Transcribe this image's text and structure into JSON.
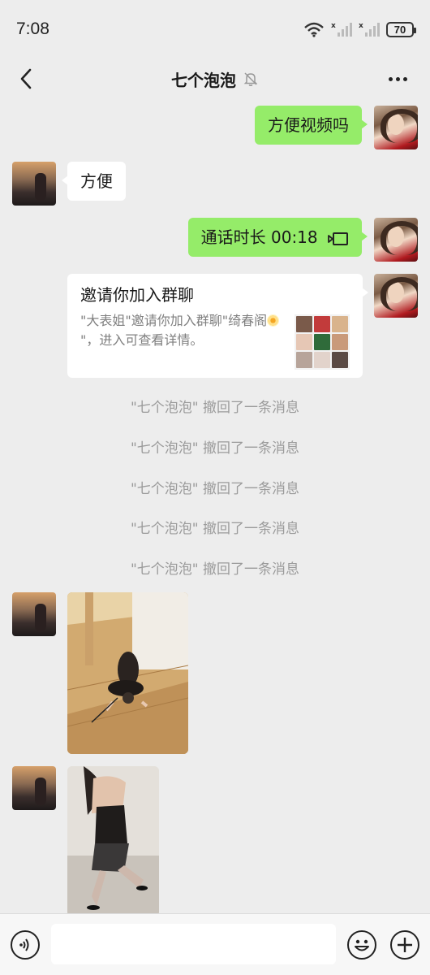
{
  "status_bar": {
    "time": "7:08",
    "battery": "70"
  },
  "header": {
    "title": "七个泡泡"
  },
  "messages": {
    "m1_text": "方便视频吗",
    "m2_text": "方便",
    "m3_text": "通话时长 00:18",
    "invite": {
      "title": "邀请你加入群聊",
      "desc_part1": "\"大表姐\"邀请你加入群聊\"绮春阁",
      "desc_part2": "\"，进入可查看详情。"
    },
    "recalls": [
      "\"七个泡泡\" 撤回了一条消息",
      "\"七个泡泡\" 撤回了一条消息",
      "\"七个泡泡\" 撤回了一条消息",
      "\"七个泡泡\" 撤回了一条消息",
      "\"七个泡泡\" 撤回了一条消息"
    ]
  },
  "input": {
    "value": ""
  },
  "colors": {
    "background": "#ededed",
    "sent_bubble": "#95ec69",
    "received_bubble": "#ffffff",
    "system_text": "#9b9b9b"
  },
  "icons": {
    "back": "chevron-left-icon",
    "mute": "bell-off-icon",
    "more": "more-dots-icon",
    "voice": "voice-icon",
    "emoji": "smile-icon",
    "plus": "plus-icon"
  }
}
